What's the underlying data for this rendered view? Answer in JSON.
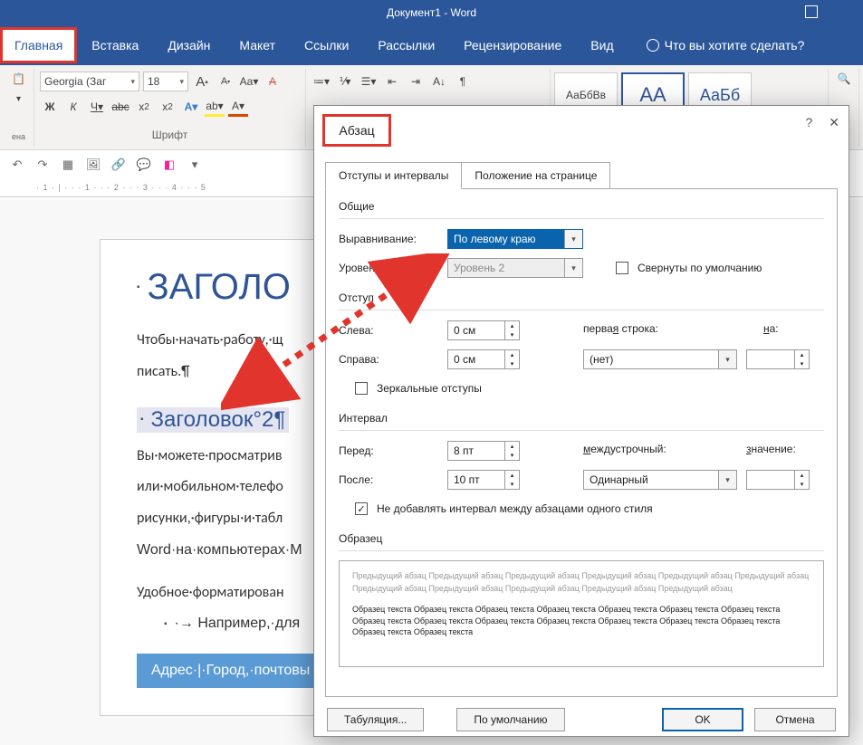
{
  "title": "Документ1 - Word",
  "ribbon": {
    "tabs": [
      "Главная",
      "Вставка",
      "Дизайн",
      "Макет",
      "Ссылки",
      "Рассылки",
      "Рецензирование",
      "Вид"
    ],
    "tellme": "Что вы хотите сделать?",
    "font": {
      "name": "Georgia (Заг",
      "size": "18",
      "group_label": "Шрифт"
    },
    "styles": {
      "normal": "АаБбВв",
      "h1": "АА",
      "h2": "АаБб"
    }
  },
  "doc": {
    "h1": "ЗАГОЛО",
    "p1": "Чтобы·начать·работу,·щ",
    "p1b": "писать.¶",
    "h2": "Заголовок°2¶",
    "p2": "Вы·можете·просматрив",
    "p3": "или·мобильном·телефо",
    "p4": "рисунки,·фигуры·и·табл",
    "p5_a": "Word",
    "p5_b": "·на·компьютерах·M",
    "p6": "Удобное·форматирован",
    "li1": "·→ Например,·для",
    "footer": "Адрес·|·Город,·почтовы"
  },
  "dialog": {
    "title": "Абзац",
    "tab1": "Отступы и интервалы",
    "tab2": "Положение на странице",
    "general": {
      "section": "Общие",
      "align_label": "Выравнивание:",
      "align_value": "По левому краю",
      "level_label": "Уровень:",
      "level_value": "Уровень 2",
      "collapsed": "Свернуты по умолчанию"
    },
    "indent": {
      "section": "Отступ",
      "left_label": "Слева:",
      "left_value": "0 см",
      "right_label": "Справа:",
      "right_value": "0 см",
      "first_label": "первая строка:",
      "first_value": "(нет)",
      "by_label": "на:",
      "by_value": "",
      "mirror": "Зеркальные отступы"
    },
    "spacing": {
      "section": "Интервал",
      "before_label": "Перед:",
      "before_value": "8 пт",
      "after_label": "После:",
      "after_value": "10 пт",
      "line_label": "междустрочный:",
      "line_value": "Одинарный",
      "at_label": "значение:",
      "at_value": "",
      "nospace": "Не добавлять интервал между абзацами одного стиля"
    },
    "preview": {
      "section": "Образец",
      "prev_text": "Предыдущий абзац Предыдущий абзац Предыдущий абзац Предыдущий абзац Предыдущий абзац Предыдущий абзац Предыдущий абзац Предыдущий абзац Предыдущий абзац Предыдущий абзац Предыдущий абзац",
      "sample_text": "Образец текста Образец текста Образец текста Образец текста Образец текста Образец текста Образец текста Образец текста Образец текста Образец текста Образец текста Образец текста Образец текста Образец текста Образец текста Образец текста"
    },
    "buttons": {
      "tabs": "Табуляция...",
      "default": "По умолчанию",
      "ok": "OK",
      "cancel": "Отмена"
    }
  },
  "ribbon_icons": {
    "increase_font": "A",
    "decrease_font": "A",
    "case": "Aa",
    "clear": "A",
    "bold": "Ж",
    "italic": "К",
    "underline": "Ч",
    "strike": "abc",
    "sub": "x₂",
    "sup": "x²",
    "texteffects": "A",
    "highlight": "ab",
    "fontcolor": "A"
  }
}
